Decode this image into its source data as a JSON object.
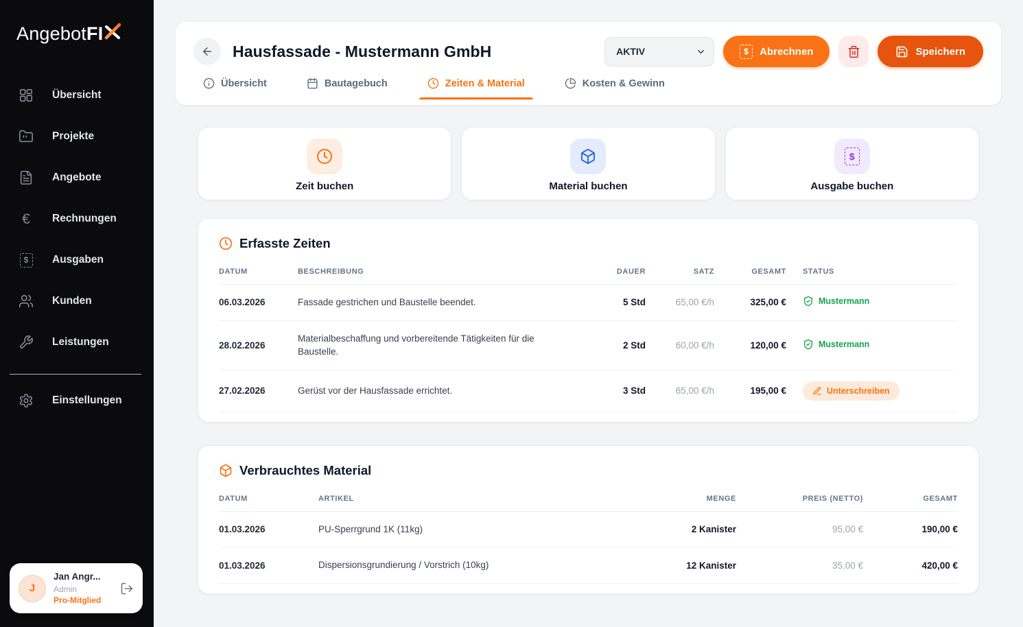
{
  "brand": {
    "part1": "Angebot",
    "part2": "FI"
  },
  "colors": {
    "accent": "#f97316",
    "accent_dark": "#e7540d",
    "green": "#16a34a",
    "red": "#dc2626",
    "blue": "#2563eb",
    "purple": "#9333ea"
  },
  "sidebar": {
    "items": [
      {
        "label": "Übersicht"
      },
      {
        "label": "Projekte"
      },
      {
        "label": "Angebote"
      },
      {
        "label": "Rechnungen"
      },
      {
        "label": "Ausgaben"
      },
      {
        "label": "Kunden"
      },
      {
        "label": "Leistungen"
      }
    ],
    "settings_label": "Einstellungen",
    "user": {
      "initial": "J",
      "name": "Jan Angr...",
      "role": "Admin",
      "membership": "Pro-Mitglied"
    }
  },
  "header": {
    "title": "Hausfassade - Mustermann GmbH",
    "status_value": "AKTIV",
    "abrechnen_label": "Abrechnen",
    "speichern_label": "Speichern",
    "tabs": [
      {
        "label": "Übersicht"
      },
      {
        "label": "Bautagebuch"
      },
      {
        "label": "Zeiten & Material"
      },
      {
        "label": "Kosten & Gewinn"
      }
    ]
  },
  "quick_actions": [
    {
      "label": "Zeit buchen"
    },
    {
      "label": "Material buchen"
    },
    {
      "label": "Ausgabe buchen"
    }
  ],
  "times": {
    "title": "Erfasste Zeiten",
    "columns": {
      "datum": "DATUM",
      "beschreibung": "BESCHREIBUNG",
      "dauer": "DAUER",
      "satz": "SATZ",
      "gesamt": "GESAMT",
      "status": "STATUS"
    },
    "rows": [
      {
        "datum": "06.03.2026",
        "beschreibung": "Fassade gestrichen und Baustelle beendet.",
        "dauer": "5 Std",
        "satz": "65,00 €/h",
        "gesamt": "325,00 €",
        "status": "Mustermann"
      },
      {
        "datum": "28.02.2026",
        "beschreibung": "Materialbeschaffung und vorbereitende Tätigkeiten für die Baustelle.",
        "dauer": "2 Std",
        "satz": "60,00 €/h",
        "gesamt": "120,00 €",
        "status": "Mustermann"
      },
      {
        "datum": "27.02.2026",
        "beschreibung": "Gerüst vor der Hausfassade errichtet.",
        "dauer": "3 Std",
        "satz": "65,00 €/h",
        "gesamt": "195,00 €",
        "status": "Unterschreiben"
      }
    ]
  },
  "materials": {
    "title": "Verbrauchtes Material",
    "columns": {
      "datum": "DATUM",
      "artikel": "ARTIKEL",
      "menge": "MENGE",
      "preis": "PREIS (NETTO)",
      "gesamt": "GESAMT"
    },
    "rows": [
      {
        "datum": "01.03.2026",
        "artikel": "PU-Sperrgrund 1K (11kg)",
        "menge": "2 Kanister",
        "preis": "95,00 €",
        "gesamt": "190,00 €"
      },
      {
        "datum": "01.03.2026",
        "artikel": "Dispersionsgrundierung / Vorstrich (10kg)",
        "menge": "12 Kanister",
        "preis": "35,00 €",
        "gesamt": "420,00 €"
      }
    ]
  },
  "icon_names": [
    "dashboard-grid-icon",
    "folder-icon",
    "file-text-icon",
    "euro-icon",
    "receipt-dollar-icon",
    "users-icon",
    "wrench-icon",
    "gear-icon",
    "logout-icon",
    "back-arrow-icon",
    "chevron-down-icon",
    "trash-icon",
    "save-icon",
    "info-icon",
    "calendar-icon",
    "clock-icon",
    "pie-chart-icon",
    "package-icon",
    "shield-check-icon",
    "pen-icon",
    "brand-check-icon"
  ]
}
